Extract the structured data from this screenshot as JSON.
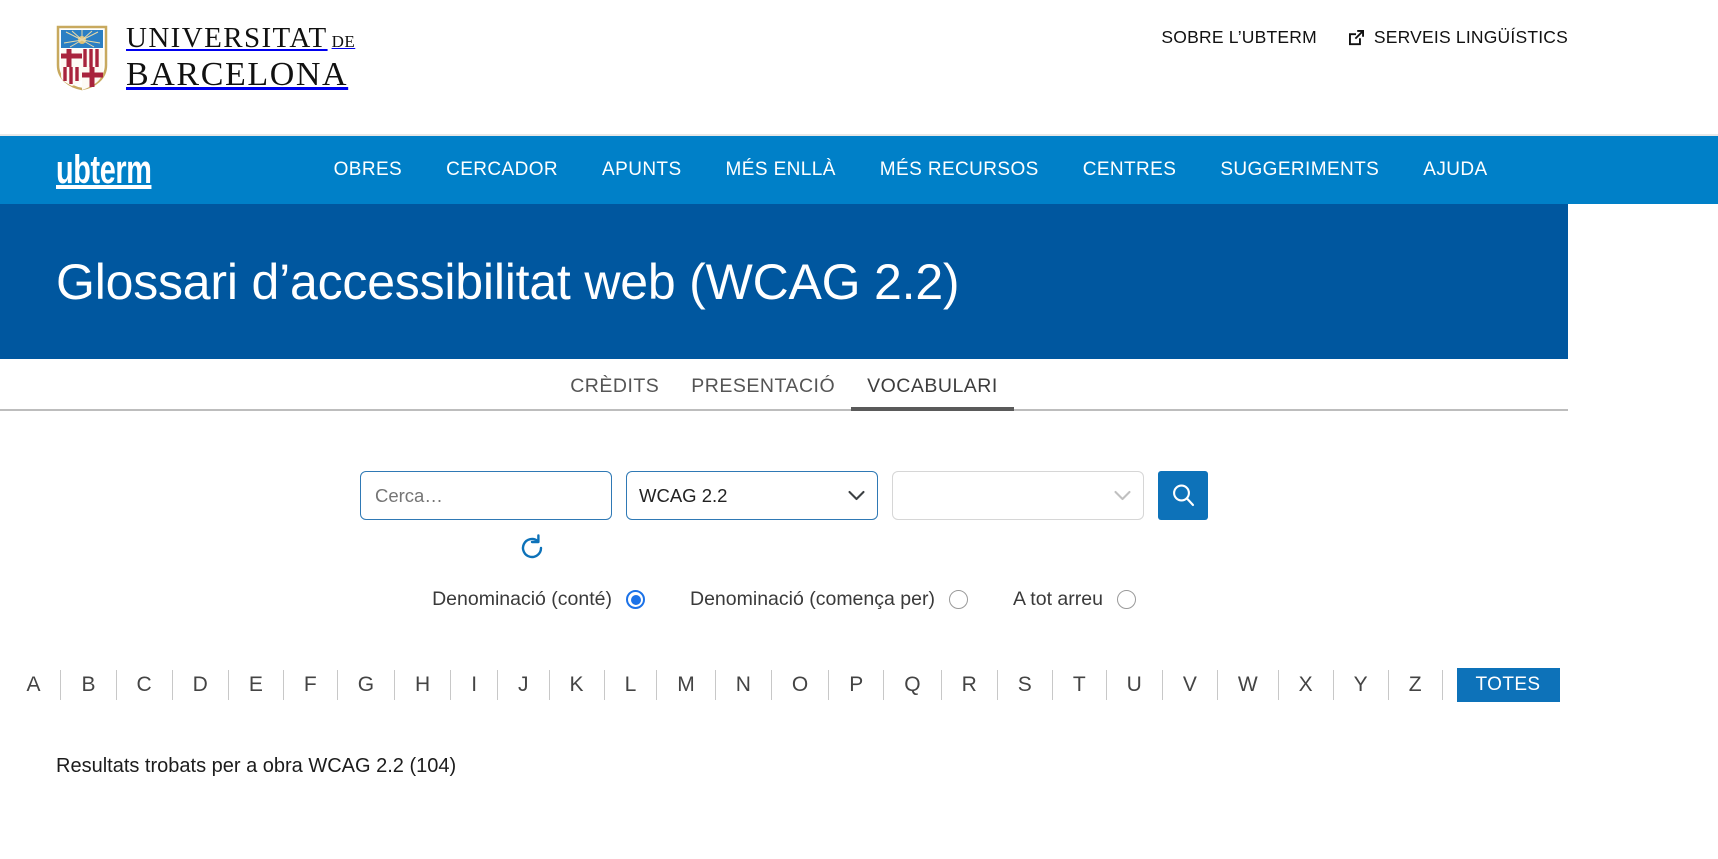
{
  "header": {
    "university_line1": "UNIVERSITAT",
    "university_line1_suffix": "DE",
    "university_line2": "BARCELONA",
    "crest_icon": "ub-crest-icon",
    "top_links": [
      {
        "label": "SOBRE L’UBTERM",
        "icon": null
      },
      {
        "label": "SERVEIS LINGÜÍSTICS",
        "icon": "external-link-icon"
      }
    ]
  },
  "navbar": {
    "brand": "ubterm",
    "items": [
      {
        "label": "OBRES"
      },
      {
        "label": "CERCADOR"
      },
      {
        "label": "APUNTS"
      },
      {
        "label": "MÉS ENLLÀ"
      },
      {
        "label": "MÉS RECURSOS"
      },
      {
        "label": "CENTRES"
      },
      {
        "label": "SUGGERIMENTS"
      },
      {
        "label": "AJUDA"
      }
    ],
    "background_color": "#0080c8"
  },
  "banner": {
    "title": "Glossari d’accessibilitat web (WCAG 2.2)",
    "background_color": "#00579f"
  },
  "tabs": [
    {
      "label": "CRÈDITS",
      "active": false
    },
    {
      "label": "PRESENTACIÓ",
      "active": false
    },
    {
      "label": "VOCABULARI",
      "active": true
    }
  ],
  "search": {
    "text_input": {
      "value": "",
      "placeholder": "Cerca…"
    },
    "work_select": {
      "value": "WCAG 2.2",
      "options": [
        "WCAG 2.2"
      ]
    },
    "second_select": {
      "value": "",
      "options": []
    },
    "search_button_icon": "search-icon",
    "reset_button_icon": "refresh-icon",
    "scope_options": [
      {
        "label": "Denominació (conté)",
        "selected": true
      },
      {
        "label": "Denominació (comença per)",
        "selected": false
      },
      {
        "label": "A tot arreu",
        "selected": false
      }
    ],
    "accent_color": "#0d72b9",
    "radio_color": "#1b72e8"
  },
  "alphabet": {
    "letters": [
      "A",
      "B",
      "C",
      "D",
      "E",
      "F",
      "G",
      "H",
      "I",
      "J",
      "K",
      "L",
      "M",
      "N",
      "O",
      "P",
      "Q",
      "R",
      "S",
      "T",
      "U",
      "V",
      "W",
      "X",
      "Y",
      "Z"
    ],
    "all_label": "TOTES",
    "all_active": true
  },
  "results": {
    "text": "Resultats trobats per a obra WCAG 2.2 (104)"
  }
}
